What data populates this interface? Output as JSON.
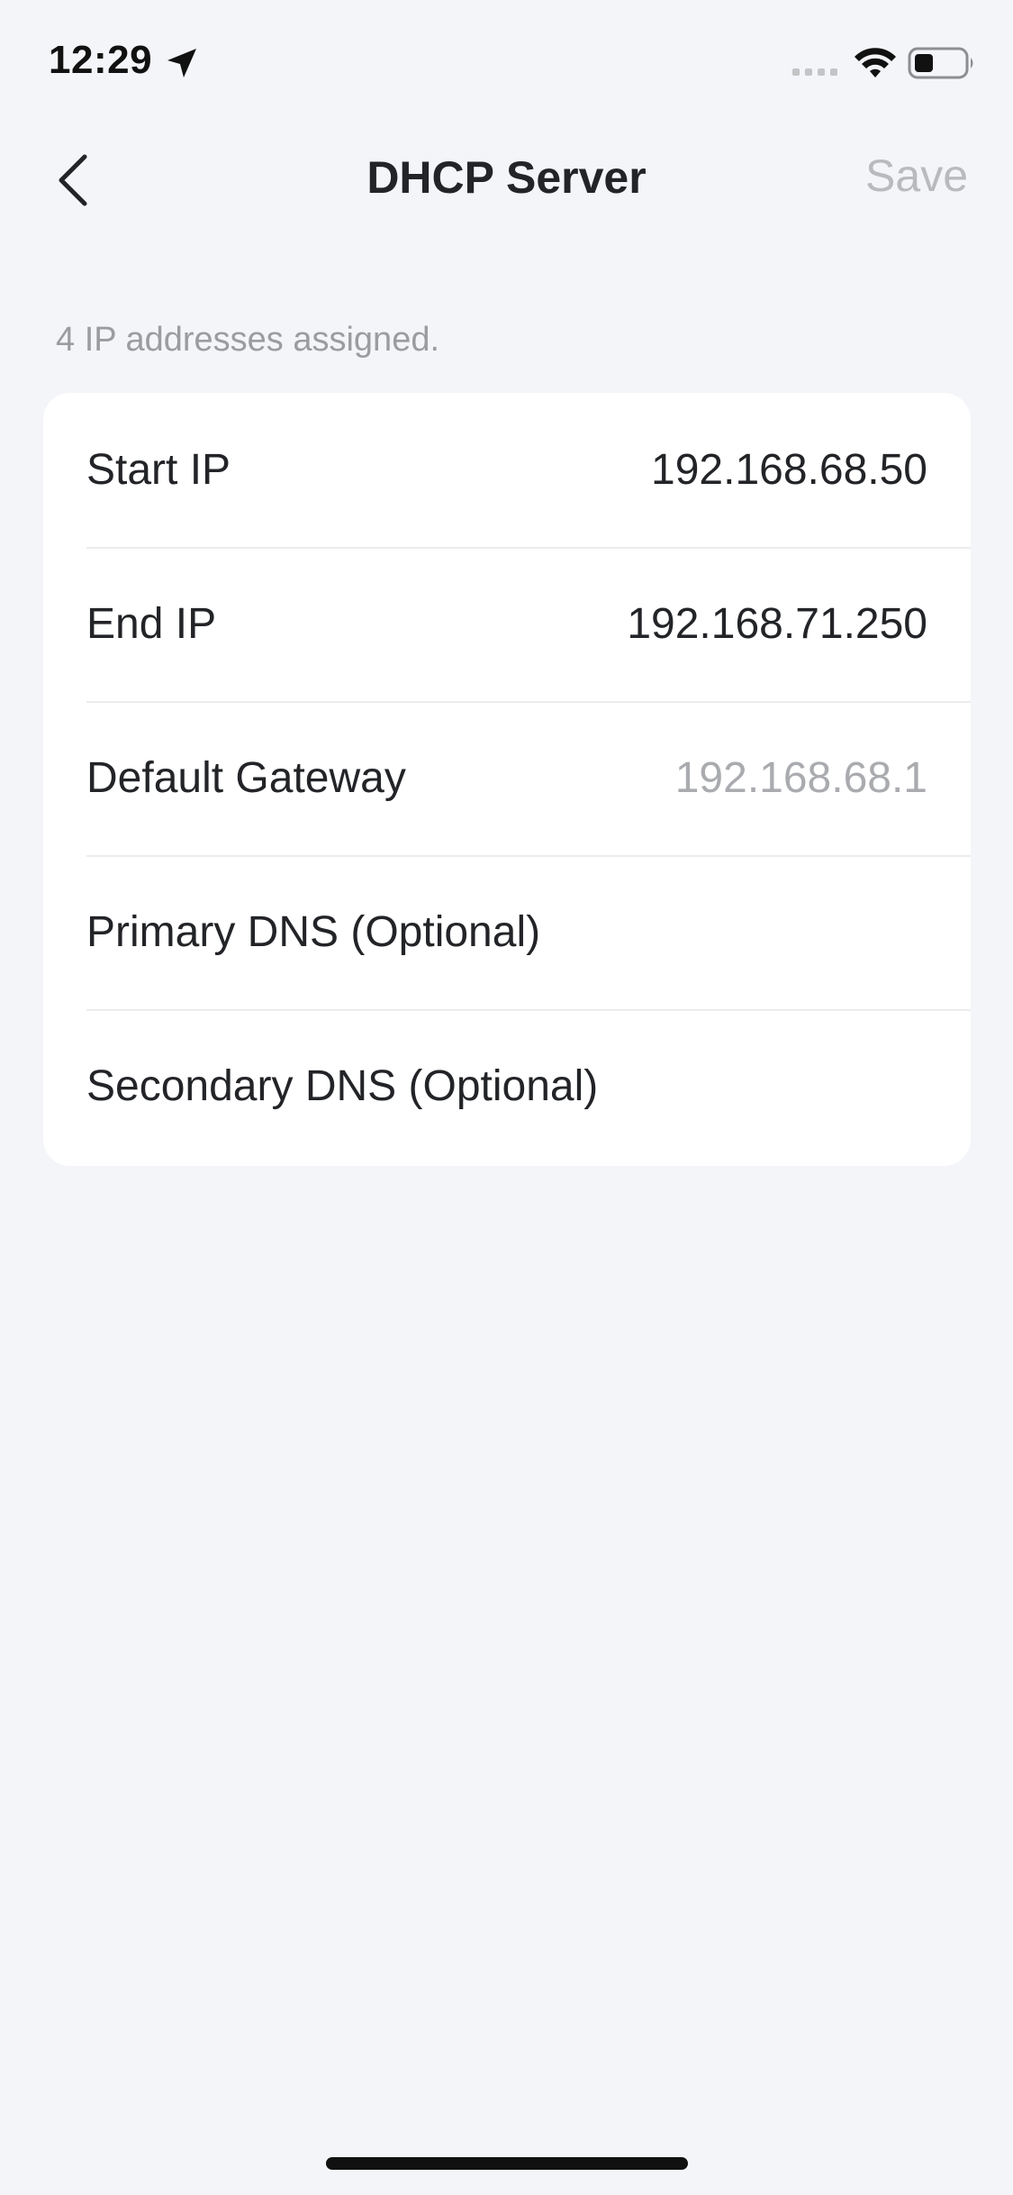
{
  "status_bar": {
    "time": "12:29",
    "icons": [
      "location-arrow-icon",
      "cellular-signal-icon",
      "wifi-icon",
      "battery-icon"
    ]
  },
  "nav": {
    "back_icon": "chevron-left-icon",
    "title": "DHCP Server",
    "save_label": "Save"
  },
  "caption": "4 IP addresses assigned.",
  "fields": [
    {
      "label": "Start IP",
      "value": "192.168.68.50"
    },
    {
      "label": "End IP",
      "value": "192.168.71.250"
    },
    {
      "label": "Default Gateway",
      "value": "192.168.68.1"
    },
    {
      "label": "Primary DNS (Optional)",
      "value": ""
    },
    {
      "label": "Secondary DNS (Optional)",
      "value": ""
    }
  ],
  "colors": {
    "background": "#f4f5f9",
    "card": "#ffffff",
    "text_primary": "#222427",
    "text_muted": "#a9abaf",
    "save_disabled": "#b8babd"
  }
}
